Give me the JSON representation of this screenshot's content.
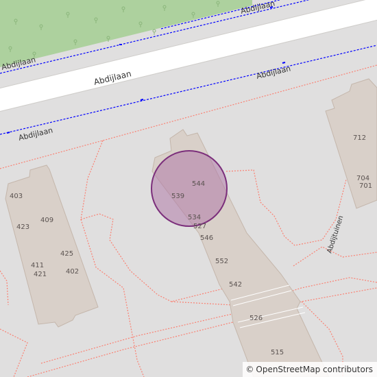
{
  "colors": {
    "background": "#e0dfdf",
    "park": "#add19e",
    "road": "#ffffff",
    "road_casing": "#cfcdca",
    "building": "#d9d0c9",
    "building_stroke": "#c4b6ab",
    "footway": "#fa8072",
    "cycleway": "#0000ff",
    "marker_fill": "#b07aa8",
    "marker_stroke": "#7b2e7b"
  },
  "streets": [
    {
      "id": "top-cycleway",
      "label": "Abdijlaan"
    },
    {
      "id": "north-cycleway",
      "label": "Abdijlaan"
    },
    {
      "id": "main-road",
      "label": "Abdijlaan"
    },
    {
      "id": "south-cycleway-right",
      "label": "Abdijlaan"
    },
    {
      "id": "south-cycleway-left",
      "label": "Abdijlaan"
    },
    {
      "id": "path",
      "label": "Abdijtuinen"
    }
  ],
  "house_numbers": {
    "left_block": [
      "403",
      "423",
      "409",
      "425",
      "411",
      "421",
      "402"
    ],
    "center_block": [
      "544",
      "539",
      "534",
      "527",
      "546",
      "552",
      "542",
      "526",
      "515"
    ],
    "right_block": [
      "712",
      "704",
      "701"
    ]
  },
  "marker": {
    "kind": "location-circle"
  },
  "attribution": {
    "symbol": "©",
    "text": "OpenStreetMap contributors"
  }
}
